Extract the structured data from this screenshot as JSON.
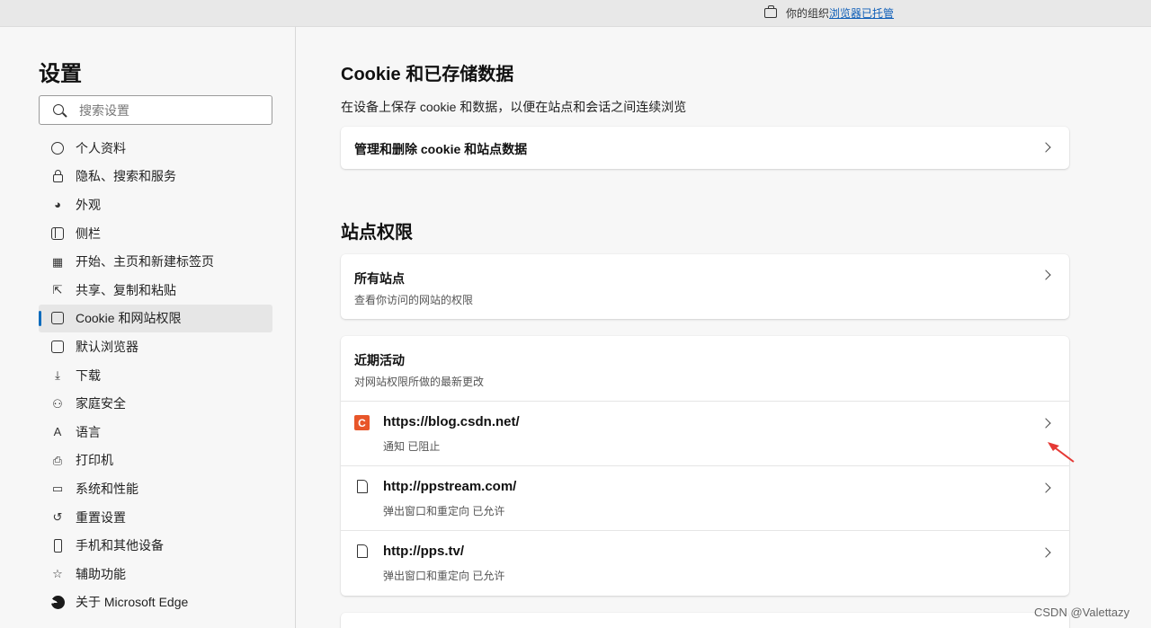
{
  "topbar": {
    "org_text": "你的组织",
    "managed_link": "浏览器已托管"
  },
  "sidebar": {
    "title": "设置",
    "search_placeholder": "搜索设置",
    "items": [
      {
        "label": "个人资料",
        "icon": "profile-icon"
      },
      {
        "label": "隐私、搜索和服务",
        "icon": "lock-icon"
      },
      {
        "label": "外观",
        "icon": "palette-icon"
      },
      {
        "label": "侧栏",
        "icon": "sidebar-icon"
      },
      {
        "label": "开始、主页和新建标签页",
        "icon": "home-icon"
      },
      {
        "label": "共享、复制和粘贴",
        "icon": "share-icon"
      },
      {
        "label": "Cookie 和网站权限",
        "icon": "cookie-icon",
        "active": true
      },
      {
        "label": "默认浏览器",
        "icon": "browser-icon"
      },
      {
        "label": "下载",
        "icon": "download-icon"
      },
      {
        "label": "家庭安全",
        "icon": "family-icon"
      },
      {
        "label": "语言",
        "icon": "language-icon"
      },
      {
        "label": "打印机",
        "icon": "printer-icon"
      },
      {
        "label": "系统和性能",
        "icon": "laptop-icon"
      },
      {
        "label": "重置设置",
        "icon": "reset-icon"
      },
      {
        "label": "手机和其他设备",
        "icon": "phone-icon"
      },
      {
        "label": "辅助功能",
        "icon": "accessibility-icon"
      },
      {
        "label": "关于 Microsoft Edge",
        "icon": "edge-icon"
      }
    ]
  },
  "main": {
    "cookie_section": {
      "title": "Cookie 和已存储数据",
      "description": "在设备上保存 cookie 和数据，以便在站点和会话之间连续浏览",
      "manage_label": "管理和删除 cookie 和站点数据"
    },
    "permissions_section": {
      "title": "站点权限",
      "all_sites": {
        "title": "所有站点",
        "subtitle": "查看你访问的网站的权限"
      },
      "recent": {
        "title": "近期活动",
        "subtitle": "对网站权限所做的最新更改",
        "sites": [
          {
            "url": "https://blog.csdn.net/",
            "status": "通知 已阻止",
            "icon": "csdn-favicon",
            "favicon_letter": "C"
          },
          {
            "url": "http://ppstream.com/",
            "status": "弹出窗口和重定向 已允许",
            "icon": "file-icon"
          },
          {
            "url": "http://pps.tv/",
            "status": "弹出窗口和重定向 已允许",
            "icon": "file-icon"
          }
        ]
      }
    }
  },
  "watermark": "CSDN @Valettazy",
  "colors": {
    "accent": "#0f6cbd",
    "csdn": "#e8562a",
    "arrow": "#e53935"
  }
}
